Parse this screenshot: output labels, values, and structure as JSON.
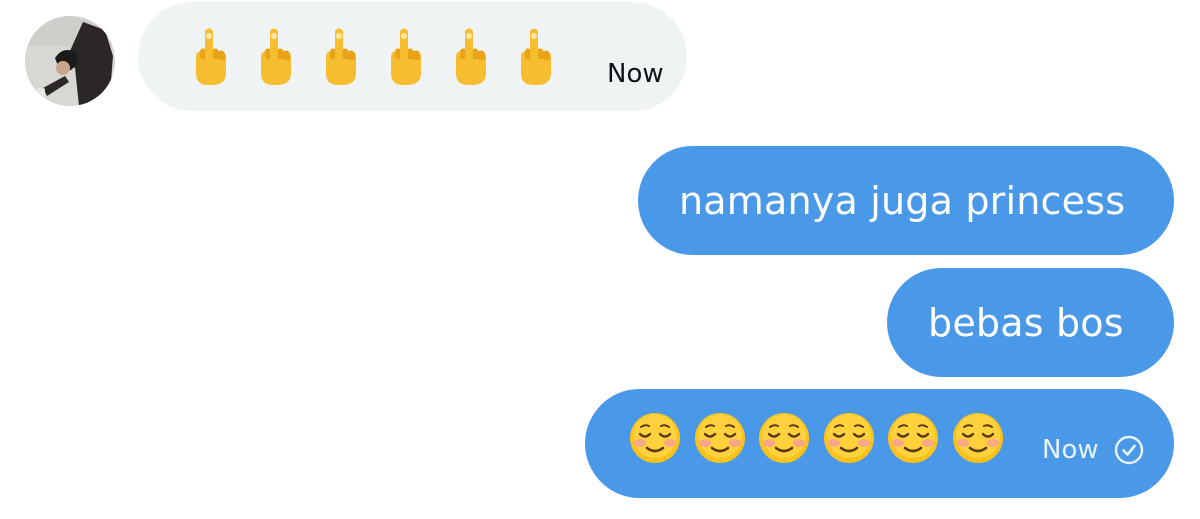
{
  "conversation": {
    "incoming": [
      {
        "emojis": [
          "middle-finger-emoji",
          "middle-finger-emoji",
          "middle-finger-emoji",
          "middle-finger-emoji",
          "middle-finger-emoji",
          "middle-finger-emoji"
        ],
        "time": "Now"
      }
    ],
    "outgoing": [
      {
        "text": "namanya juga princess"
      },
      {
        "text": "bebas bos"
      },
      {
        "emojis": [
          "smiling-face-emoji",
          "smiling-face-emoji",
          "smiling-face-emoji",
          "smiling-face-emoji",
          "smiling-face-emoji",
          "smiling-face-emoji"
        ],
        "time": "Now",
        "status_icon": "check-circle-icon"
      }
    ]
  },
  "colors": {
    "incoming_bubble": "#eff3f4",
    "outgoing_bubble": "#4a99e9",
    "outgoing_text": "#ffffff"
  }
}
